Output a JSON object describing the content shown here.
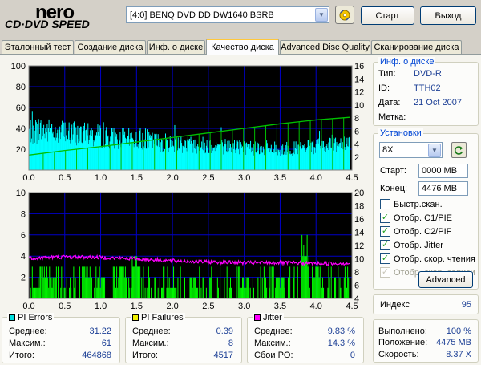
{
  "header": {
    "logo_top": "nero",
    "logo_bottom": "CD·DVD SPEED",
    "drive": "[4:0]  BENQ DVD DD DW1640 BSRB",
    "start_label": "Старт",
    "exit_label": "Выход"
  },
  "tabs": [
    {
      "label": "Эталонный тест"
    },
    {
      "label": "Создание диска"
    },
    {
      "label": "Инф. о диске"
    },
    {
      "label": "Качество диска"
    },
    {
      "label": "Advanced Disc Quality"
    },
    {
      "label": "Сканирование диска"
    }
  ],
  "active_tab_index": 3,
  "disc_info": {
    "title": "Инф. о диске",
    "type_label": "Тип:",
    "type_value": "DVD-R",
    "id_label": "ID:",
    "id_value": "TTH02",
    "date_label": "Дата:",
    "date_value": "21 Oct 2007",
    "mark_label": "Метка:",
    "mark_value": ""
  },
  "settings": {
    "title": "Установки",
    "speed": "8X",
    "start_label": "Старт:",
    "start_value": "0000 MB",
    "end_label": "Конец:",
    "end_value": "4476 MB",
    "quick_scan": "Быстр.скан.",
    "show_c1": "Отобр. C1/PIE",
    "show_c2": "Отобр. C2/PIF",
    "show_jitter": "Отобр. Jitter",
    "show_read": "Отобр. скор. чтения",
    "show_write": "Отобр. скор. записи",
    "advanced_label": "Advanced"
  },
  "checkboxes": {
    "quick_scan": false,
    "show_c1": true,
    "show_c2": true,
    "show_jitter": true,
    "show_read": true,
    "show_write": true
  },
  "index": {
    "label": "Индекс",
    "value": "95"
  },
  "progress": {
    "done_label": "Выполнено:",
    "done_value": "100 %",
    "pos_label": "Положение:",
    "pos_value": "4475 MB",
    "speed_label": "Скорость:",
    "speed_value": "8.37 X"
  },
  "pi_errors": {
    "title": "PI Errors",
    "color": "#00e0e0",
    "avg_label": "Среднее:",
    "avg": "31.22",
    "max_label": "Максим.:",
    "max": "61",
    "total_label": "Итого:",
    "total": "464868"
  },
  "pi_failures": {
    "title": "PI Failures",
    "color": "#f0f000",
    "avg_label": "Среднее:",
    "avg": "0.39",
    "max_label": "Максим.:",
    "max": "8",
    "total_label": "Итого:",
    "total": "4517"
  },
  "jitter": {
    "title": "Jitter",
    "color": "#ff00ff",
    "avg_label": "Среднее:",
    "avg": "9.83 %",
    "max_label": "Максим.:",
    "max": "14.3 %",
    "po_label": "Сбои PO:",
    "po": "0"
  },
  "colors": {
    "plot_bg": "#000000",
    "grid": "#0000c8",
    "pie": "#00ffff",
    "pif": "#00ff00",
    "jitter": "#ff00ff",
    "speed": "#00c000"
  },
  "chart_data": [
    {
      "type": "area",
      "title": "PI Errors",
      "xlim": [
        0,
        4.5
      ],
      "ylim_left": [
        0,
        100
      ],
      "ylim_right": [
        0,
        16
      ],
      "x_ticks": [
        "0.0",
        "0.5",
        "1.0",
        "1.5",
        "2.0",
        "2.5",
        "3.0",
        "3.5",
        "4.0",
        "4.5"
      ],
      "y_ticks_left": [
        "20",
        "40",
        "60",
        "80",
        "100"
      ],
      "y_ticks_right": [
        "2",
        "4",
        "6",
        "8",
        "10",
        "12",
        "14",
        "16"
      ],
      "series": [
        {
          "values": [
            [
              0,
              45
            ],
            [
              0.25,
              44
            ],
            [
              0.5,
              42
            ],
            [
              0.75,
              40
            ],
            [
              1.0,
              38
            ],
            [
              1.25,
              36
            ],
            [
              1.5,
              34
            ],
            [
              1.75,
              32
            ],
            [
              2.0,
              30
            ],
            [
              2.25,
              29
            ],
            [
              2.5,
              28
            ],
            [
              2.75,
              27
            ],
            [
              3.0,
              26
            ],
            [
              3.25,
              25
            ],
            [
              3.5,
              24
            ],
            [
              3.75,
              24
            ],
            [
              4.0,
              26
            ],
            [
              4.25,
              30
            ],
            [
              4.47,
              32
            ]
          ]
        },
        {
          "values": [
            [
              0,
              2.3
            ],
            [
              0.5,
              3.0
            ],
            [
              1.0,
              3.6
            ],
            [
              1.5,
              4.3
            ],
            [
              2.0,
              5.0
            ],
            [
              2.5,
              5.7
            ],
            [
              3.0,
              6.4
            ],
            [
              3.5,
              7.1
            ],
            [
              4.0,
              7.7
            ],
            [
              4.47,
              8.1
            ]
          ]
        }
      ]
    },
    {
      "type": "bar",
      "title": "PI Failures / Jitter",
      "xlim": [
        0,
        4.5
      ],
      "ylim_left": [
        0,
        10
      ],
      "ylim_right": [
        4,
        20
      ],
      "x_ticks": [
        "0.0",
        "0.5",
        "1.0",
        "1.5",
        "2.0",
        "2.5",
        "3.0",
        "3.5",
        "4.0",
        "4.5"
      ],
      "y_ticks_left": [
        "2",
        "4",
        "6",
        "8",
        "10"
      ],
      "y_ticks_right": [
        "4",
        "6",
        "8",
        "10",
        "12",
        "14",
        "16",
        "18",
        "20"
      ],
      "series": [
        {
          "values": [
            [
              0.1,
              1
            ],
            [
              0.3,
              2
            ],
            [
              0.8,
              3
            ],
            [
              1.0,
              2
            ],
            [
              1.3,
              3
            ],
            [
              1.5,
              4
            ],
            [
              2.0,
              1
            ],
            [
              2.3,
              2
            ],
            [
              3.0,
              2
            ],
            [
              3.5,
              2
            ],
            [
              3.85,
              6
            ],
            [
              4.0,
              3
            ]
          ]
        },
        {
          "values": [
            [
              0,
              10.1
            ],
            [
              0.5,
              10.3
            ],
            [
              1.0,
              10.2
            ],
            [
              1.5,
              10.0
            ],
            [
              2.0,
              9.7
            ],
            [
              2.5,
              9.5
            ],
            [
              3.0,
              9.4
            ],
            [
              3.5,
              9.4
            ],
            [
              4.0,
              9.3
            ],
            [
              4.47,
              9.3
            ]
          ]
        }
      ]
    }
  ]
}
